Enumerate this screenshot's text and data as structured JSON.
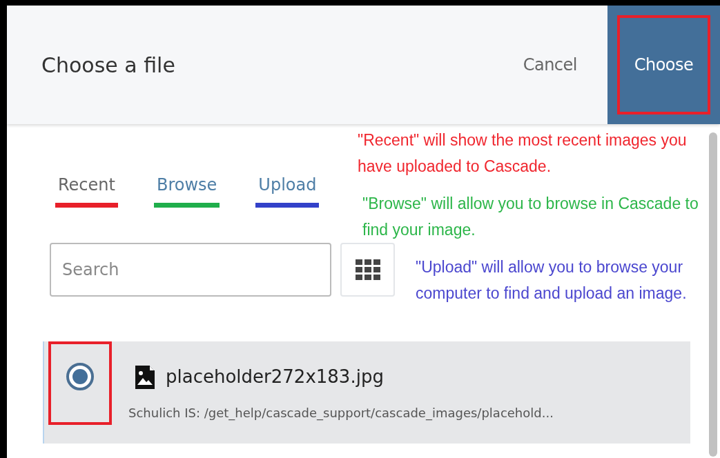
{
  "dialog": {
    "title": "Choose a file",
    "cancel": "Cancel",
    "choose": "Choose",
    "choose_highlighted": true
  },
  "tabs": [
    {
      "label": "Recent",
      "selected": true,
      "color": "#e8202a"
    },
    {
      "label": "Browse",
      "selected": false,
      "color": "#1fae4b"
    },
    {
      "label": "Upload",
      "selected": false,
      "color": "#3341c9"
    }
  ],
  "annotations": [
    {
      "text": "\"Recent\" will show the most recent images you have uploaded to Cascade.",
      "color": "#f0262e"
    },
    {
      "text": "\"Browse\" will allow you to browse in Cascade to find your image.",
      "color": "#2db64a"
    },
    {
      "text": "\"Upload\" will allow you to browse your computer to find and upload an image.",
      "color": "#4b47cf"
    }
  ],
  "search": {
    "placeholder": "Search"
  },
  "files": [
    {
      "name": "placeholder272x183.jpg",
      "path": "Schulich IS: /get_help/cascade_support/cascade_images/placehold...",
      "selected": true,
      "radio_highlighted": true
    }
  ]
}
